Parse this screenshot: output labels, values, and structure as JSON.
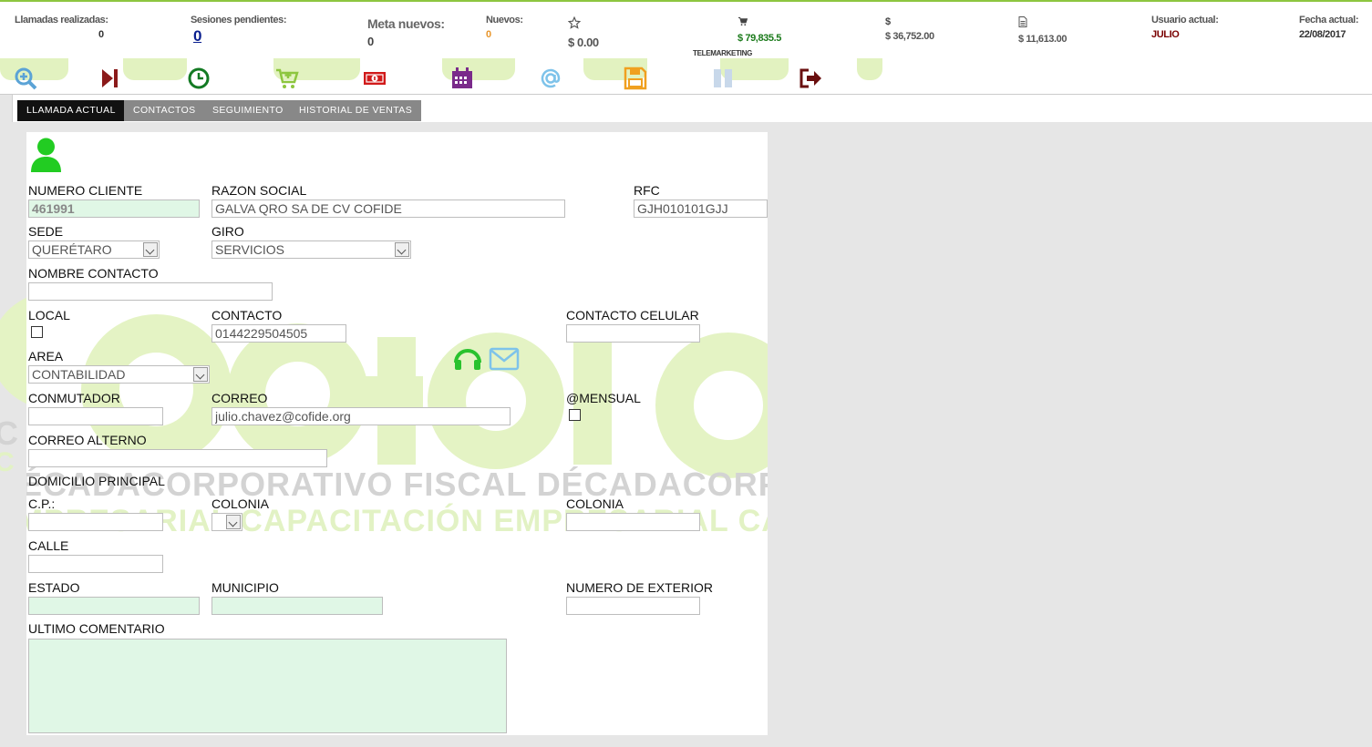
{
  "stats": {
    "llamadas_label": "Llamadas realizadas:",
    "llamadas_value": "0",
    "sesiones_label": "Sesiones pendientes:",
    "sesiones_value": "0",
    "meta_label": "Meta nuevos:",
    "meta_value": "0",
    "nuevos_label": "Nuevos:",
    "nuevos_value": "0",
    "star_value": "$ 0.00",
    "cart_value": "$ 79,835.5",
    "dollar_symbol": "$",
    "dollar_value": "$ 36,752.00",
    "doc_value": "$ 11,613.00",
    "usuario_label": "Usuario actual:",
    "usuario_value": "JULIO",
    "fecha_label": "Fecha actual:",
    "fecha_value": "22/08/2017",
    "section_label": "TELEMARKETING"
  },
  "toolbar": {
    "icons": [
      "search-zoom-icon",
      "skip-next-icon",
      "clock-icon",
      "add-cart-icon",
      "money-icon",
      "calendar-icon",
      "at-sign-icon",
      "save-icon",
      "pause-icon",
      "logout-icon"
    ]
  },
  "tabs": [
    "LLAMADA ACTUAL",
    "CONTACTOS",
    "SEGUIMIENTO",
    "HISTORIAL DE VENTAS"
  ],
  "form": {
    "numero_cliente_label": "NUMERO CLIENTE",
    "numero_cliente_value": "461991",
    "razon_social_label": "RAZON SOCIAL",
    "razon_social_value": "GALVA QRO SA DE CV COFIDE",
    "rfc_label": "RFC",
    "rfc_value": "GJH010101GJJ",
    "sede_label": "SEDE",
    "sede_value": "QUERÉTARO",
    "giro_label": "GIRO",
    "giro_value": "SERVICIOS",
    "nombre_contacto_label": "NOMBRE CONTACTO",
    "nombre_contacto_value": "",
    "local_label": "LOCAL",
    "contacto_label": "CONTACTO",
    "contacto_value": "0144229504505",
    "contacto_celular_label": "CONTACTO CELULAR",
    "contacto_celular_value": "",
    "area_label": "AREA",
    "area_value": "CONTABILIDAD",
    "conmutador_label": "CONMUTADOR",
    "conmutador_value": "",
    "correo_label": "CORREO",
    "correo_value": "julio.chavez@cofide.org",
    "mensual_label": "@MENSUAL",
    "correo_alterno_label": "CORREO ALTERNO",
    "correo_alterno_value": "",
    "domicilio_label": "DOMICILIO PRINCIPAL",
    "cp_label": "C.P.:",
    "colonia_label": "COLONIA",
    "colonia2_label": "COLONIA",
    "calle_label": "CALLE",
    "estado_label": "ESTADO",
    "municipio_label": "MUNICIPIO",
    "numero_exterior_label": "NUMERO DE EXTERIOR",
    "ultimo_comentario_label": "ULTIMO COMENTARIO"
  },
  "watermark": {
    "line1": "DÉCADACORPORATIVO FISCAL DÉCADACORPORATIVO",
    "line2": "EMPRESARIAL CAPACITACIÓN EMPRESARIAL CAPACITACIÓN"
  },
  "colors": {
    "brand_green": "#8dc63f",
    "positive_green": "#1a7a1a",
    "user_red": "#7a0000",
    "nuevos_orange": "#e8952a",
    "active_tab": "#111111",
    "inactive_tab": "#888888"
  }
}
